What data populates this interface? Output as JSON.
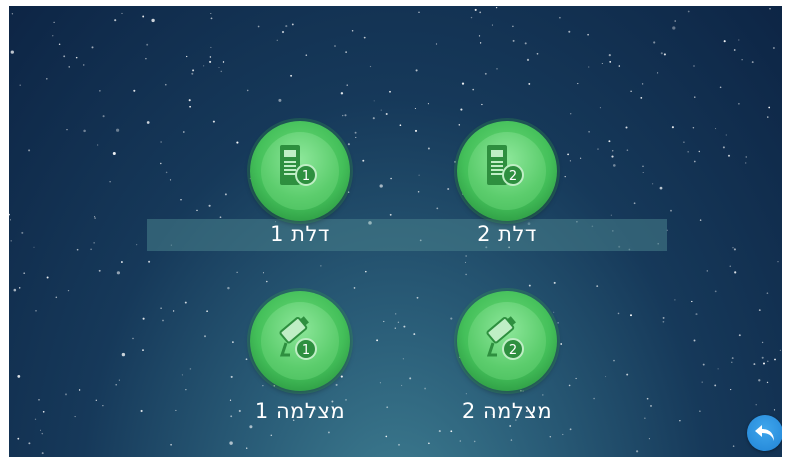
{
  "tiles": [
    {
      "id": "door-1",
      "label": "דלת 1",
      "icon": "door-panel-icon",
      "badge": "1"
    },
    {
      "id": "door-2",
      "label": "דלת 2",
      "icon": "door-panel-icon",
      "badge": "2"
    },
    {
      "id": "camera-1",
      "label": "מצלמה 1",
      "icon": "security-camera-icon",
      "badge": "1"
    },
    {
      "id": "camera-2",
      "label": "מצלמה 2",
      "icon": "security-camera-icon",
      "badge": "2"
    }
  ],
  "back_button": {
    "icon": "back-arrow-icon"
  },
  "colors": {
    "tile_green": "#44c05a",
    "tile_green_dark": "#2b8e40",
    "back_blue": "#2184d6",
    "background_top": "#0d2545",
    "background_bottom": "#3f7f92"
  }
}
